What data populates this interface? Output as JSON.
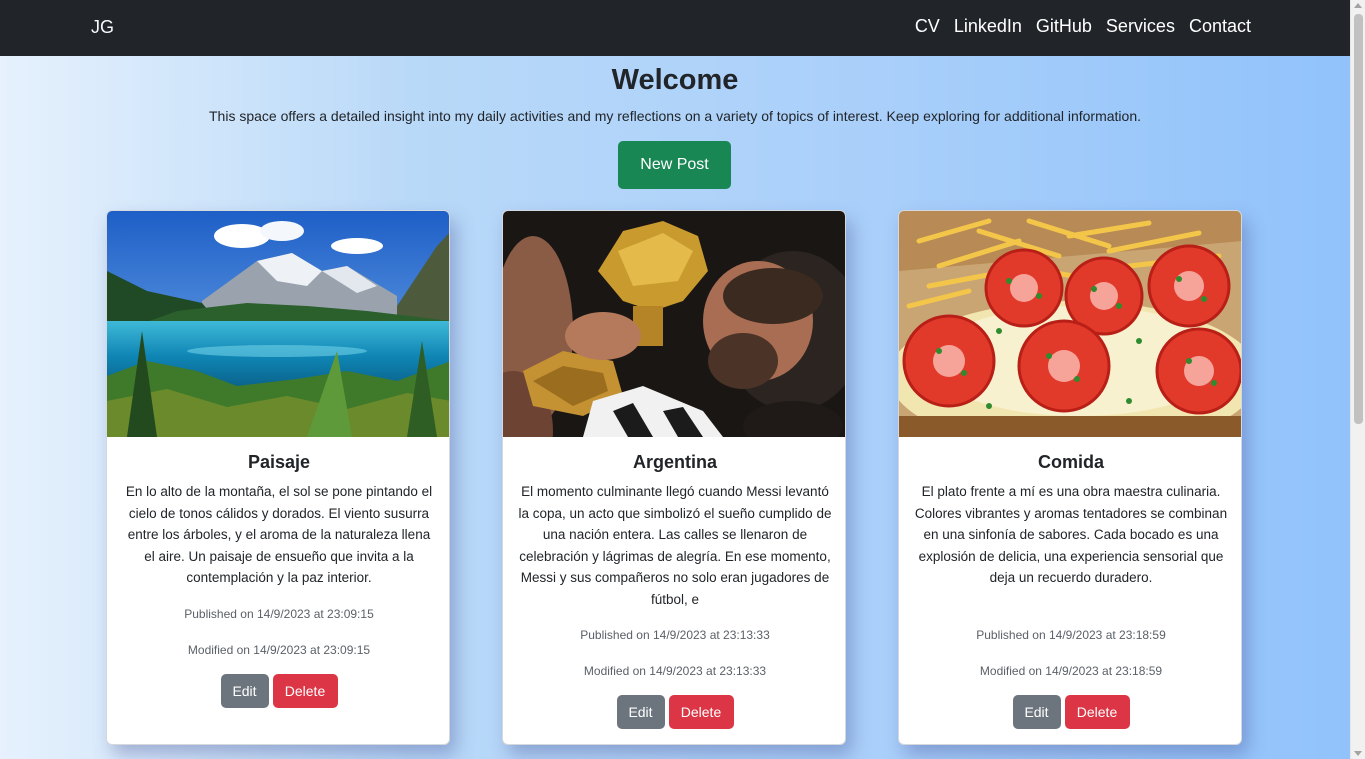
{
  "navbar": {
    "brand": "JG",
    "links": [
      "CV",
      "LinkedIn",
      "GitHub",
      "Services",
      "Contact"
    ]
  },
  "hero": {
    "title": "Welcome",
    "subtitle": "This space offers a detailed insight into my daily activities and my reflections on a variety of topics of interest. Keep exploring for additional information.",
    "new_post_label": "New Post"
  },
  "posts": [
    {
      "title": "Paisaje",
      "image": "mountain-lake-landscape-photo",
      "body": "En lo alto de la montaña, el sol se pone pintando el cielo de tonos cálidos y dorados. El viento susurra entre los árboles, y el aroma de la naturaleza llena el aire. Un paisaje de ensueño que invita a la contemplación y la paz interior.",
      "published": "Published on 14/9/2023 at 23:09:15",
      "modified": "Modified on 14/9/2023 at 23:09:15",
      "edit_label": "Edit",
      "delete_label": "Delete"
    },
    {
      "title": "Argentina",
      "image": "messi-kissing-world-cup-trophy-photo",
      "body": "El momento culminante llegó cuando Messi levantó la copa, un acto que simbolizó el sueño cumplido de una nación entera. Las calles se llenaron de celebración y lágrimas de alegría. En ese momento, Messi y sus compañeros no solo eran jugadores de fútbol, e",
      "published": "Published on 14/9/2023 at 23:13:33",
      "modified": "Modified on 14/9/2023 at 23:13:33",
      "edit_label": "Edit",
      "delete_label": "Delete"
    },
    {
      "title": "Comida",
      "image": "milanesa-napolitana-with-fries-photo",
      "body": "El plato frente a mí es una obra maestra culinaria. Colores vibrantes y aromas tentadores se combinan en una sinfonía de sabores. Cada bocado es una explosión de delicia, una experiencia sensorial que deja un recuerdo duradero.",
      "published": "Published on 14/9/2023 at 23:18:59",
      "modified": "Modified on 14/9/2023 at 23:18:59",
      "edit_label": "Edit",
      "delete_label": "Delete"
    }
  ],
  "colors": {
    "navbar": "#212529",
    "success": "#198754",
    "secondary": "#6c757d",
    "danger": "#dc3545"
  }
}
